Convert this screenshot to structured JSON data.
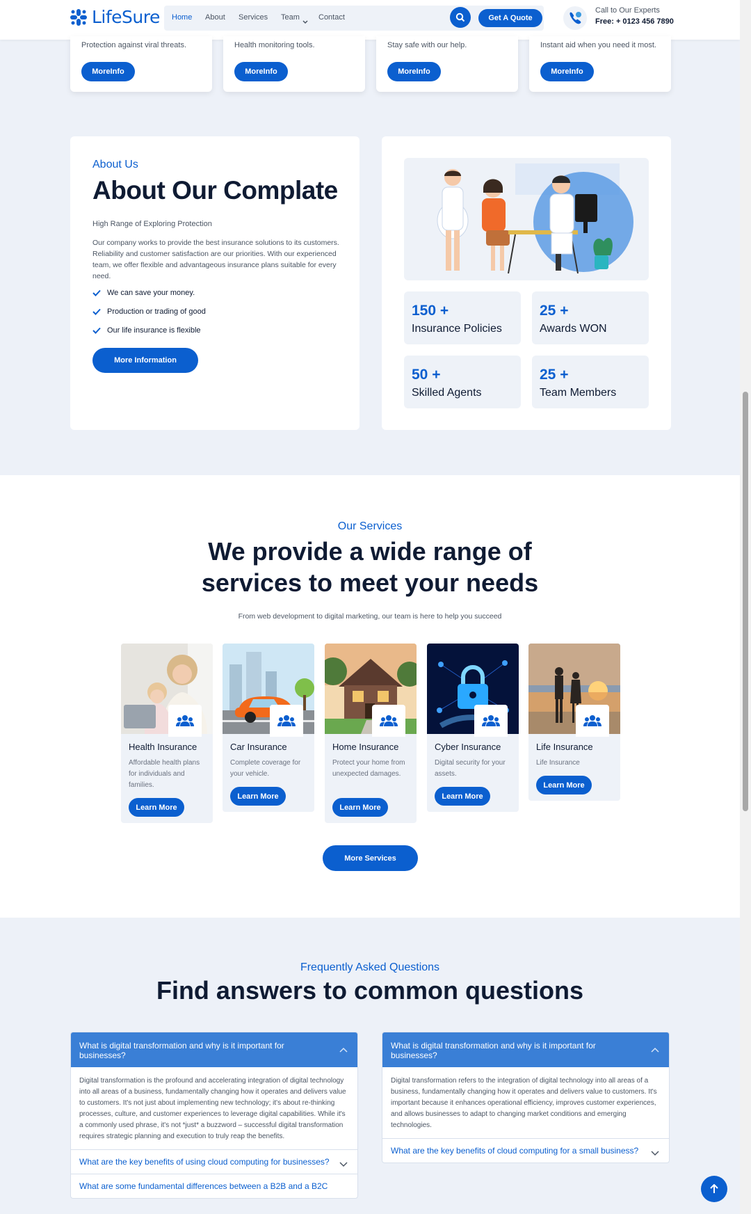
{
  "header": {
    "logo": "LifeSure",
    "nav": [
      "Home",
      "About",
      "Services",
      "Team",
      "Contact"
    ],
    "quote_btn": "Get A Quote",
    "call_label": "Call to Our Experts",
    "call_number": "Free: + 0123 456 7890"
  },
  "features": [
    {
      "text": "Protection against viral threats.",
      "btn": "MoreInfo"
    },
    {
      "text": "Health monitoring tools.",
      "btn": "MoreInfo"
    },
    {
      "text": "Stay safe with our help.",
      "btn": "MoreInfo"
    },
    {
      "text": "Instant aid when you need it most.",
      "btn": "MoreInfo"
    }
  ],
  "about": {
    "kicker": "About Us",
    "title": "About Our Complate",
    "subtitle": "High Range of Exploring Protection",
    "description": "Our company works to provide the best insurance solutions to its customers. Reliability and customer satisfaction are our priorities. With our experienced team, we offer flexible and advantageous insurance plans suitable for every need.",
    "checks": [
      "We can save your money.",
      "Production or trading of good",
      "Our life insurance is flexible"
    ],
    "button": "More Information",
    "stats": [
      {
        "num": "150 +",
        "label": "Insurance Policies"
      },
      {
        "num": "25 +",
        "label": "Awards WON"
      },
      {
        "num": "50 +",
        "label": "Skilled Agents"
      },
      {
        "num": "25 +",
        "label": "Team Members"
      }
    ]
  },
  "services": {
    "kicker": "Our Services",
    "title_line1": "We provide a wide range of",
    "title_line2": "services to meet your needs",
    "subtitle": "From web development to digital marketing, our team is here to help you succeed",
    "items": [
      {
        "title": "Health Insurance",
        "desc": "Affordable health plans for individuals and families.",
        "btn": "Learn More"
      },
      {
        "title": "Car Insurance",
        "desc": "Complete coverage for your vehicle.",
        "btn": "Learn More"
      },
      {
        "title": "Home Insurance",
        "desc": "Protect your home from unexpected damages.",
        "btn": "Learn More"
      },
      {
        "title": "Cyber Insurance",
        "desc": "Digital security for your assets.",
        "btn": "Learn More"
      },
      {
        "title": "Life Insurance",
        "desc": "Life Insurance",
        "btn": "Learn More"
      }
    ],
    "more_btn": "More Services"
  },
  "faq": {
    "kicker": "Frequently Asked Questions",
    "title": "Find answers to common questions",
    "left": {
      "open_q": "What is digital transformation and why is it important for businesses?",
      "open_a": "Digital transformation is the profound and accelerating integration of digital technology into all areas of a business, fundamentally changing how it operates and delivers value to customers. It's not just about implementing new technology; it's about re-thinking processes, culture, and customer experiences to leverage digital capabilities. While it's a commonly used phrase, it's not *just* a buzzword – successful digital transformation requires strategic planning and execution to truly reap the benefits.",
      "q2": "What are the key benefits of using cloud computing for businesses?",
      "q3": "What are some fundamental differences between a B2B and a B2C"
    },
    "right": {
      "open_q": "What is digital transformation and why is it important for businesses?",
      "open_a": "Digital transformation refers to the integration of digital technology into all areas of a business, fundamentally changing how it operates and delivers value to customers. It's important because it enhances operational efficiency, improves customer experiences, and allows businesses to adapt to changing market conditions and emerging technologies.",
      "q2": "What are the key benefits of cloud computing for a small business?"
    }
  },
  "colors": {
    "accent": "#0b5fcf",
    "background": "#edf1f8",
    "dark": "#0f1b33"
  }
}
